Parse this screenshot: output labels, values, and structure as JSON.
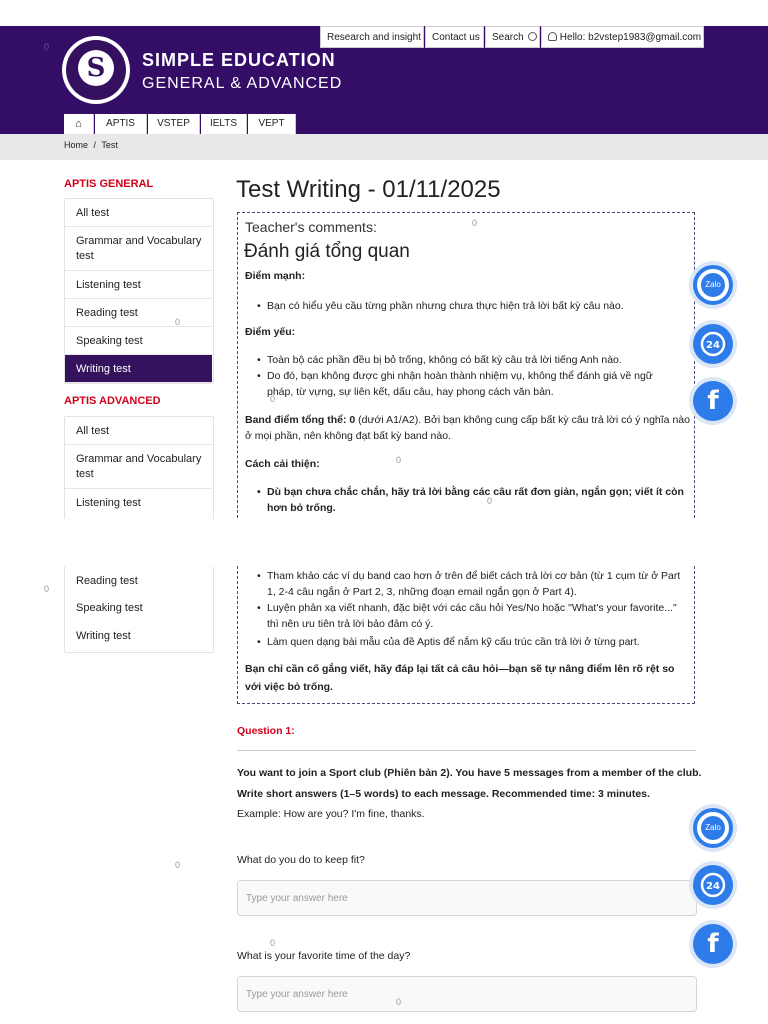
{
  "header": {
    "brand_line1": "SIMPLE EDUCATION",
    "brand_line2": "GENERAL & ADVANCED",
    "logo_text": "SIMPLE EDUCATION",
    "top_links": {
      "research": "Research and insight",
      "contact": "Contact us",
      "search": "Search",
      "user": "Hello: b2vstep1983@gmail.com"
    },
    "nav_tabs": [
      "APTIS",
      "VSTEP",
      "IELTS",
      "VEPT"
    ],
    "corner_zero": "0"
  },
  "breadcrumb": {
    "home": "Home",
    "sep": "/",
    "current": "Test"
  },
  "sidebar": {
    "general_title": "APTIS GENERAL",
    "general_items": [
      "All test",
      "Grammar and Vocabulary test",
      "Listening test",
      "Reading test",
      "Speaking test",
      "Writing test"
    ],
    "advanced_title": "APTIS ADVANCED",
    "advanced_items_top": [
      "All test",
      "Grammar and Vocabulary test",
      "Listening test"
    ],
    "advanced_items_bottom": [
      "Reading test",
      "Speaking test",
      "Writing test"
    ]
  },
  "main": {
    "title": "Test Writing - 01/11/2025",
    "comments": {
      "label": "Teacher's comments:",
      "heading": "Đánh giá tổng quan",
      "strengths_label": "Điểm mạnh:",
      "strengths": [
        "Bạn có hiểu yêu cầu từng phần nhưng chưa thực hiện trả lời bất kỳ câu nào."
      ],
      "weaknesses_label": "Điểm yếu:",
      "weaknesses": [
        "Toàn bộ các phần đều bị bỏ trống, không có bất kỳ câu trả lời tiếng Anh nào.",
        "Do đó, bạn không được ghi nhận hoàn thành nhiệm vụ, không thể đánh giá về ngữ pháp, từ vựng, sự liên kết, dấu câu, hay phong cách văn bản."
      ],
      "band_label": "Band điểm tổng thể: 0",
      "band_text": " (dưới A1/A2). Bởi bạn không cung cấp bất kỳ câu trả lời có ý nghĩa nào ở mọi phần, nên không đạt bất kỳ band nào.",
      "improve_label": "Cách cải thiện:",
      "improve_first": "Dù bạn chưa chắc chắn, hãy trả lời bằng các câu rất đơn giản, ngắn gọn; viết ít còn hơn bỏ trống.",
      "improve_rest": [
        "Tham khảo các ví dụ band cao hơn ở trên để biết cách trả lời cơ bản (từ 1 cụm từ ở Part 1, 2-4 câu ngắn ở Part 2, 3, những đoạn email ngắn gọn ở Part 4).",
        "Luyện phản xạ viết nhanh, đặc biệt với các câu hỏi Yes/No hoặc \"What's your favorite...\" thì nên ưu tiên trả lời bảo đảm có ý.",
        "Làm quen dạng bài mẫu của đề Aptis để nắm kỹ cấu trúc cần trả lời ở từng part."
      ],
      "closing": "Bạn chỉ cần cố gắng viết, hãy đáp lại tất cả câu hỏi—bạn sẽ tự nâng điểm lên rõ rệt so với việc bỏ trống."
    },
    "question": {
      "label": "Question 1:",
      "instruction": "You want to join a Sport club (Phiên bản 2). You have 5 messages from a member of the club. Write short answers (1–5 words) to each message. Recommended time: 3 minutes.",
      "example": "Example: How are you? I'm fine, thanks.",
      "items": [
        {
          "prompt": "What do you do to keep fit?",
          "placeholder": "Type your answer here"
        },
        {
          "prompt": "What is your favorite time of the day?",
          "placeholder": "Type your answer here"
        }
      ]
    }
  },
  "floating": {
    "zalo_label": "Zalo",
    "phone_badge": "24",
    "facebook_glyph": "f"
  },
  "stray_zero": "0"
}
